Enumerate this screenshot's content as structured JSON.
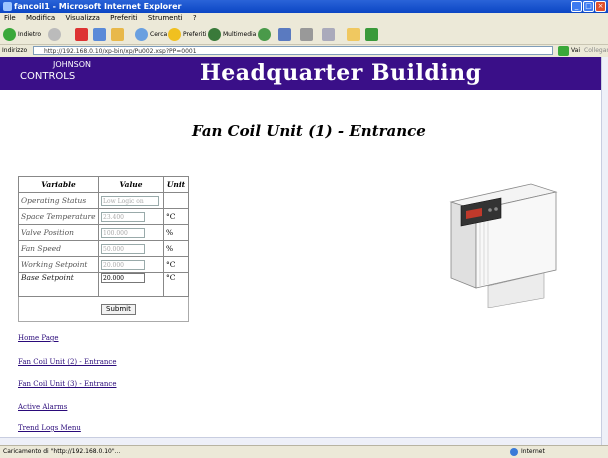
{
  "window": {
    "title": "fancoil1 - Microsoft Internet Explorer",
    "controls": [
      "_",
      "□",
      "×"
    ]
  },
  "menu": [
    "File",
    "Modifica",
    "Visualizza",
    "Preferiti",
    "Strumenti",
    "?"
  ],
  "toolbar": {
    "back_label": "Indietro",
    "search_label": "Cerca",
    "favorites_label": "Preferiti",
    "media_label": "Multimedia"
  },
  "address": {
    "label": "Indirizzo",
    "url": "http://192.168.0.10/xp-bin/xp/Pu002.xsp?PP=0001",
    "go_label": "Vai",
    "links_label": "Collegamenti"
  },
  "header": {
    "logo_main": "CONTROLS",
    "logo_top": "JOHNSON",
    "title": "Headquarter Building"
  },
  "page": {
    "title": "Fan Coil Unit (1) - Entrance"
  },
  "table": {
    "headers": [
      "Variable",
      "Value",
      "Unit"
    ],
    "rows": [
      {
        "label": "Operating Status",
        "value": "Low Logic on",
        "unit": ""
      },
      {
        "label": "Space Temperature",
        "value": "23.400",
        "unit": "°C"
      },
      {
        "label": "Valve Position",
        "value": "100.000",
        "unit": "%"
      },
      {
        "label": "Fan Speed",
        "value": "50.000",
        "unit": "%"
      },
      {
        "label": "Working Setpoint",
        "value": "20.000",
        "unit": "°C"
      },
      {
        "label": "Base Setpoint",
        "value": "20.000",
        "unit": "°C"
      }
    ],
    "submit_label": "Submit"
  },
  "links": [
    "Home Page",
    "Fan Coil Unit (2) - Entrance",
    "Fan Coil Unit (3) - Entrance",
    "Active Alarms",
    "Trend Logs Menu"
  ],
  "status": {
    "text": "Caricamento di \"http://192.168.0.10\"...",
    "zone": "Internet"
  },
  "colors": {
    "header_bg": "#3a0f88",
    "link": "#2a0a7a"
  }
}
